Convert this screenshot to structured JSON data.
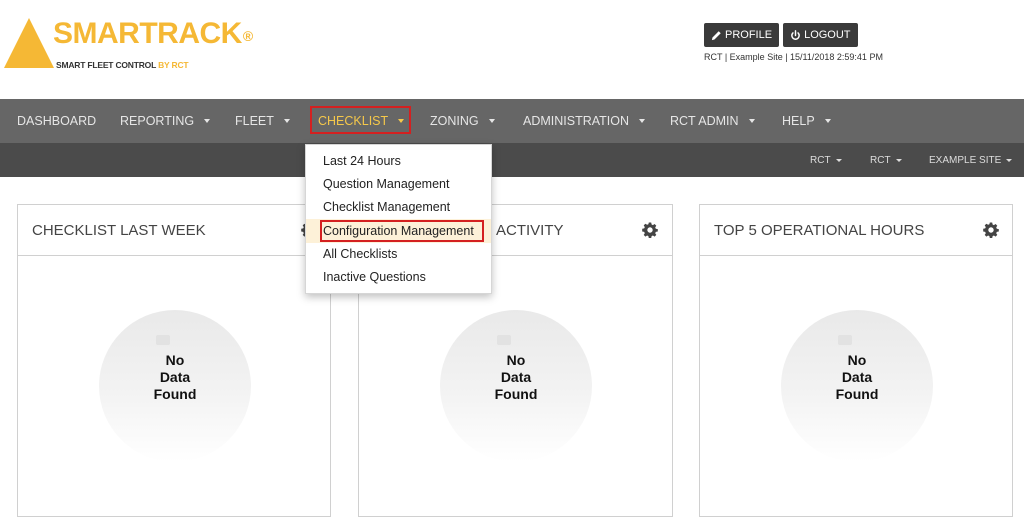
{
  "brand": {
    "name": "SMARTRACK",
    "registered": "®",
    "tagline_prefix": "SMART FLEET CONTROL ",
    "tagline_brand": "BY RCT",
    "accent_color": "#f5b835"
  },
  "header": {
    "profile_label": "PROFILE",
    "logout_label": "LOGOUT",
    "site_info": "RCT | Example Site | 15/11/2018 2:59:41 PM"
  },
  "nav": {
    "items": [
      {
        "label": "DASHBOARD"
      },
      {
        "label": "REPORTING"
      },
      {
        "label": "FLEET"
      },
      {
        "label": "CHECKLIST"
      },
      {
        "label": "ZONING"
      },
      {
        "label": "ADMINISTRATION"
      },
      {
        "label": "RCT ADMIN"
      },
      {
        "label": "HELP"
      }
    ],
    "active": "CHECKLIST"
  },
  "subnav": {
    "items": [
      {
        "label": "RCT"
      },
      {
        "label": "RCT"
      },
      {
        "label": "EXAMPLE SITE"
      }
    ]
  },
  "dropdown": {
    "items": [
      {
        "label": "Last 24 Hours"
      },
      {
        "label": "Question Management"
      },
      {
        "label": "Checklist Management"
      },
      {
        "label": "Configuration Management"
      },
      {
        "label": "All Checklists"
      },
      {
        "label": "Inactive Questions"
      }
    ],
    "highlighted": "Configuration Management"
  },
  "cards": [
    {
      "title": "CHECKLIST LAST WEEK",
      "empty_line1": "No",
      "empty_line2": "Data",
      "empty_line3": "Found"
    },
    {
      "title": "ACTIVITY",
      "empty_line1": "No",
      "empty_line2": "Data",
      "empty_line3": "Found"
    },
    {
      "title": "TOP 5 OPERATIONAL HOURS",
      "empty_line1": "No",
      "empty_line2": "Data",
      "empty_line3": "Found"
    }
  ],
  "icons": {
    "profile": "pencil-icon",
    "logout": "power-icon",
    "card_settings": "gear-icon"
  }
}
